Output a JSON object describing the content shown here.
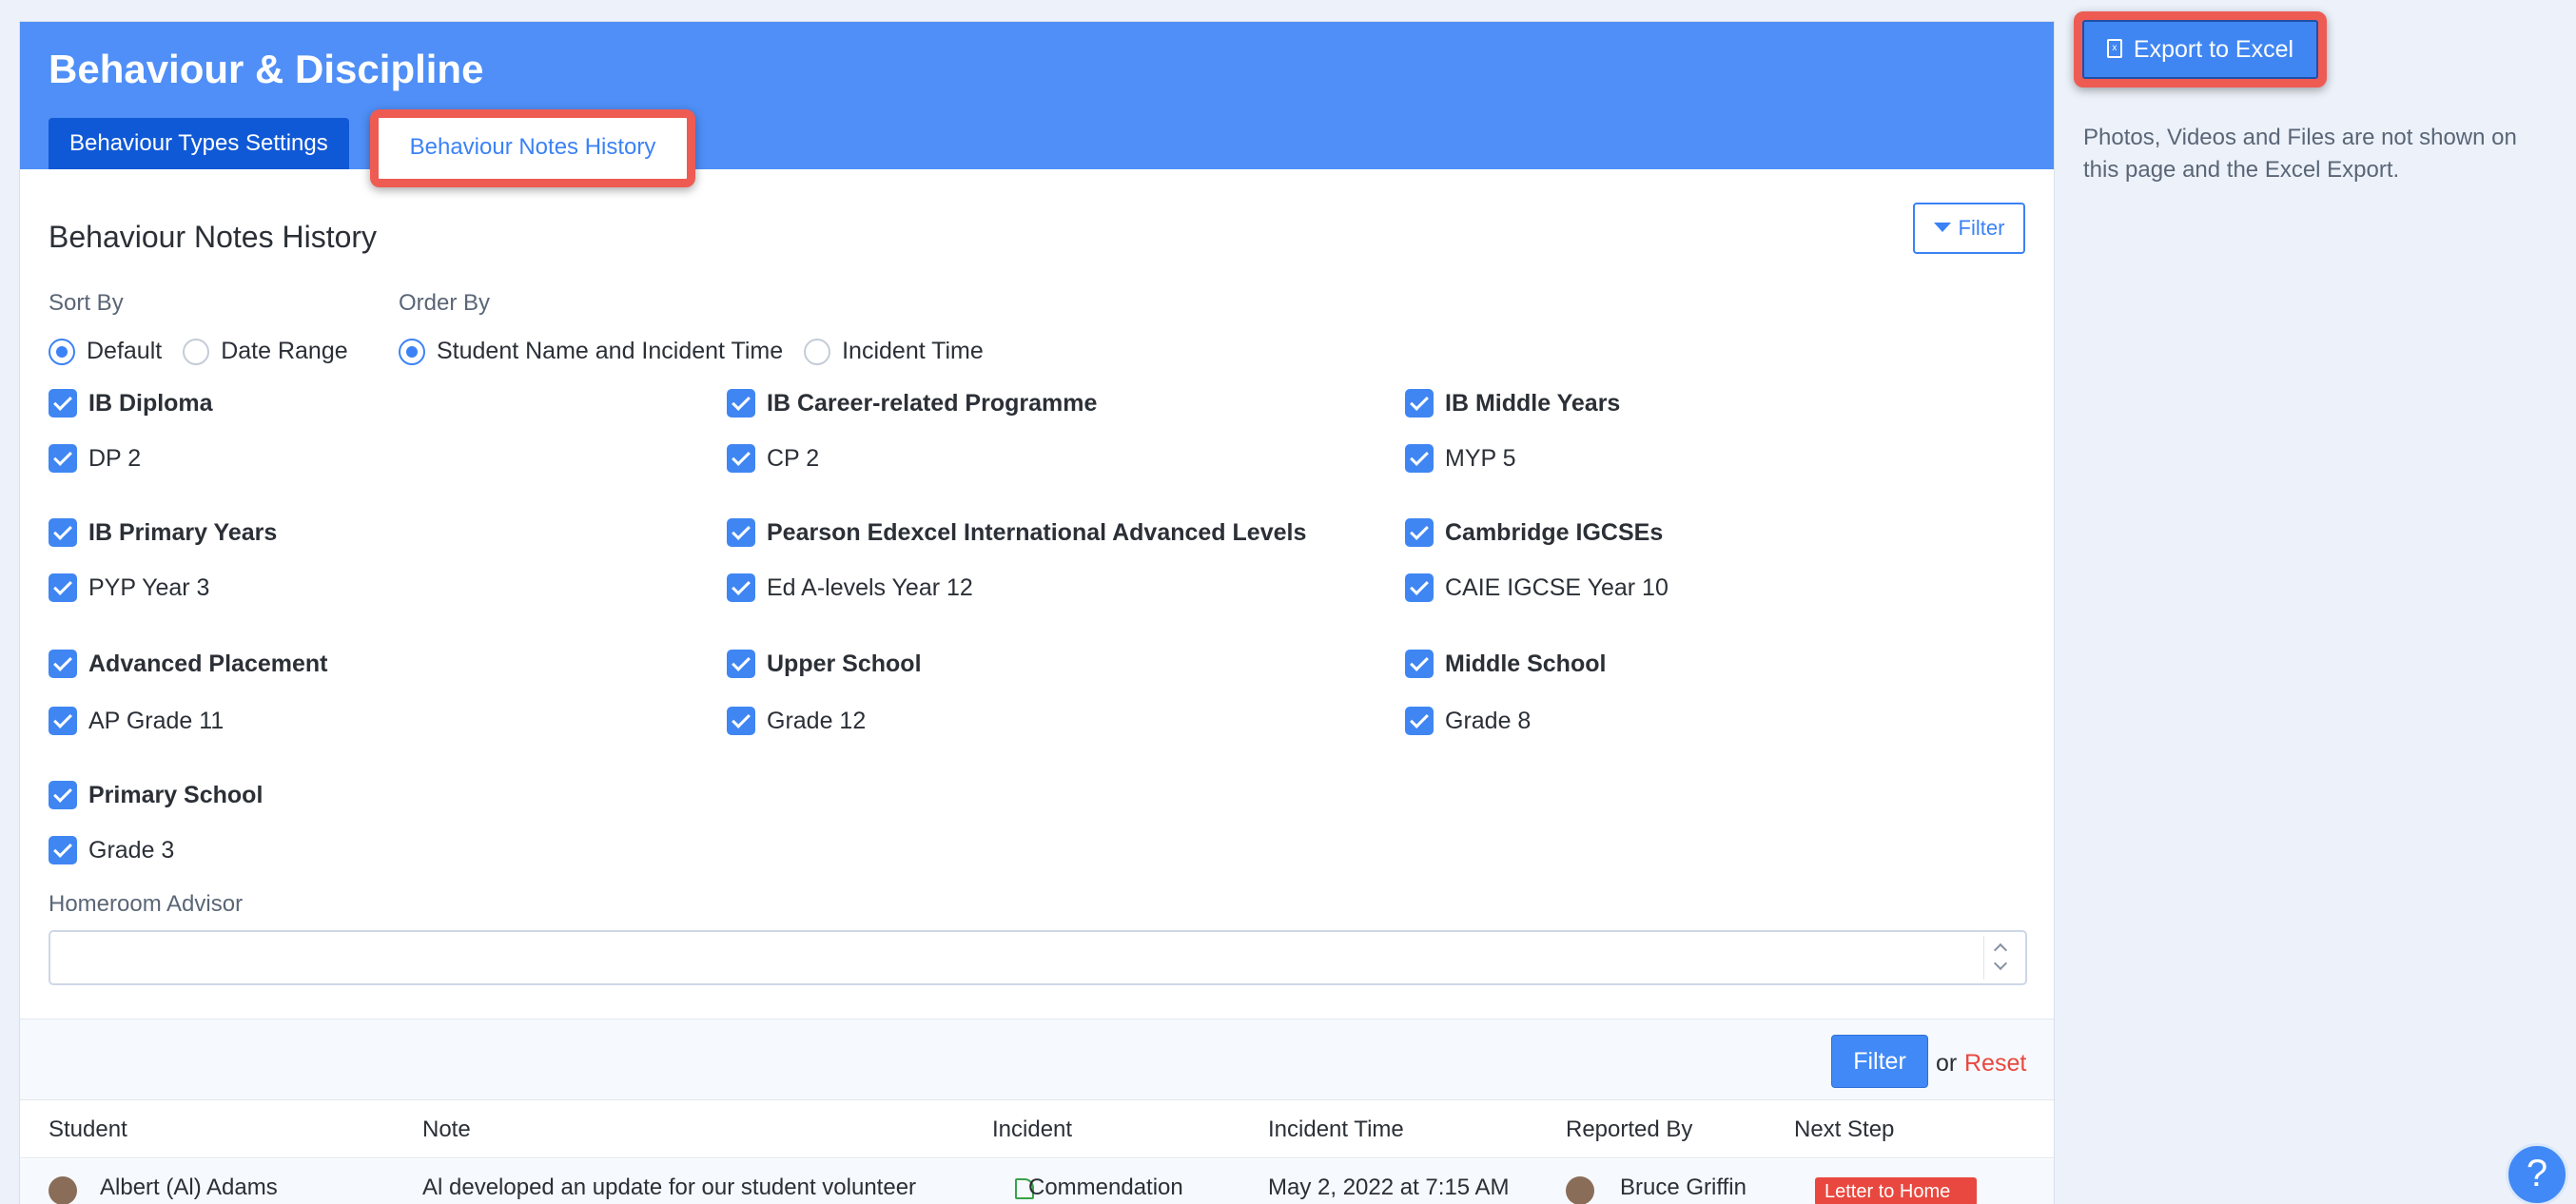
{
  "header": {
    "title": "Behaviour & Discipline",
    "tabs": [
      {
        "label": "Behaviour Types Settings"
      },
      {
        "label": "Behaviour Notes History"
      }
    ]
  },
  "main": {
    "section_title": "Behaviour Notes History",
    "filter_top_label": "Filter",
    "sort_by": {
      "label": "Sort By",
      "options": [
        "Default",
        "Date Range"
      ],
      "selected": "Default"
    },
    "order_by": {
      "label": "Order By",
      "options": [
        "Student Name and Incident Time",
        "Incident Time"
      ],
      "selected": "Student Name and Incident Time"
    },
    "programmes": [
      {
        "name": "IB Diploma",
        "grade": "DP 2"
      },
      {
        "name": "IB Career-related Programme",
        "grade": "CP 2"
      },
      {
        "name": "IB Middle Years",
        "grade": "MYP 5"
      },
      {
        "name": "IB Primary Years",
        "grade": "PYP Year 3"
      },
      {
        "name": "Pearson Edexcel International Advanced Levels",
        "grade": "Ed A-levels Year 12"
      },
      {
        "name": "Cambridge IGCSEs",
        "grade": "CAIE IGCSE Year 10"
      },
      {
        "name": "Advanced Placement",
        "grade": "AP Grade 11"
      },
      {
        "name": "Upper School",
        "grade": "Grade 12"
      },
      {
        "name": "Middle School",
        "grade": "Grade 8"
      },
      {
        "name": "Primary School",
        "grade": "Grade 3"
      }
    ],
    "homeroom_label": "Homeroom Advisor",
    "homeroom_value": "",
    "filter_button": "Filter",
    "or_text": "or",
    "reset_link": "Reset"
  },
  "table": {
    "columns": [
      "Student",
      "Note",
      "Incident",
      "Incident Time",
      "Reported By",
      "Next Step"
    ],
    "rows": [
      {
        "student": "Albert (Al) Adams",
        "note": "Al developed an update for our student volunteer",
        "incident": "Commendation",
        "incident_time": "May 2, 2022 at 7:15 AM",
        "reported_by": "Bruce Griffin",
        "next_step": "Letter to Home"
      }
    ]
  },
  "sidebar": {
    "export_label": "Export to Excel",
    "note": "Photos, Videos and Files are not shown on this page and the Excel Export."
  },
  "help_label": "?",
  "colors": {
    "header": "#4f8ff7",
    "active_tab": "#1059d6",
    "accent": "#3b82f6",
    "highlight": "#ee5b53",
    "reset": "#e8483f"
  }
}
